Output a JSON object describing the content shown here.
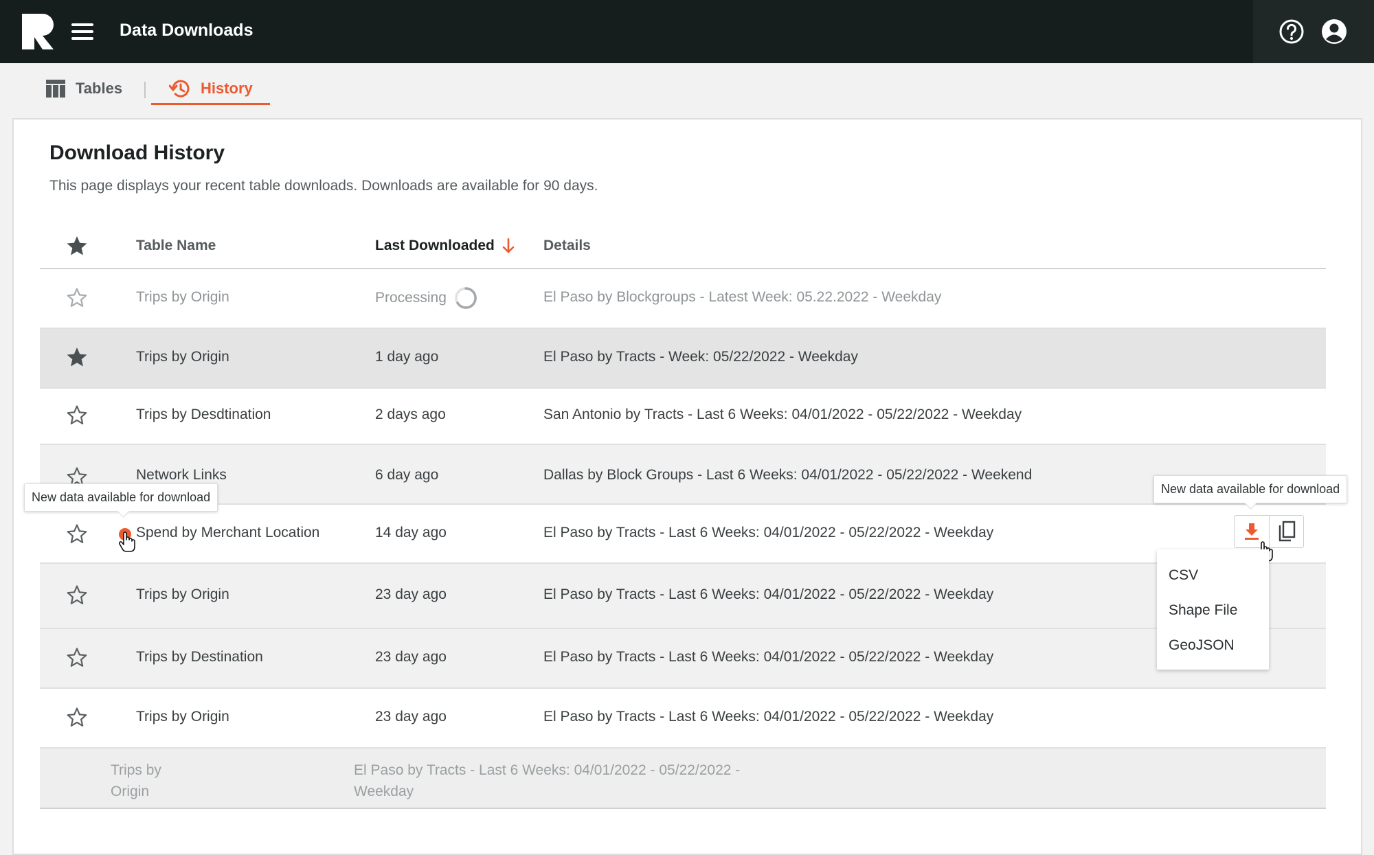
{
  "header": {
    "app_title": "Data Downloads",
    "logo_icon": "r-logo-icon",
    "menu_icon": "hamburger-menu-icon",
    "help_icon": "help-circle-icon",
    "account_icon": "account-circle-icon"
  },
  "tabs": [
    {
      "label": "Tables",
      "icon": "table-icon",
      "active": false
    },
    {
      "label": "History",
      "icon": "history-icon",
      "active": true
    }
  ],
  "page": {
    "title": "Download History",
    "subtitle": "This page displays your recent table downloads. Downloads are available for 90 days."
  },
  "table": {
    "columns": {
      "star": "star-icon",
      "name": "Table Name",
      "last_downloaded": "Last Downloaded",
      "details": "Details"
    },
    "sort": {
      "column": "Last Downloaded",
      "direction": "descending"
    },
    "rows": [
      {
        "starred": false,
        "name": "Trips by Origin",
        "last": "Processing",
        "details": "El Paso by Blockgroups - Latest Week: 05.22.2022 - Weekday",
        "status": "processing"
      },
      {
        "starred": true,
        "name": "Trips by Origin",
        "last": "1 day ago",
        "details": "El Paso by Tracts - Week: 05/22/2022 - Weekday"
      },
      {
        "starred": false,
        "name": "Trips by Desdtination",
        "last": "2 days ago",
        "details": "San Antonio by Tracts - Last 6 Weeks: 04/01/2022 - 05/22/2022 - Weekday"
      },
      {
        "starred": false,
        "name": "Network Links",
        "last": "6 day ago",
        "details": "Dallas by Block Groups - Last 6 Weeks: 04/01/2022 - 05/22/2022 - Weekend"
      },
      {
        "starred": false,
        "name": "Spend by Merchant Location",
        "last": "14 day ago",
        "details": "El Paso by Tracts - Last 6 Weeks: 04/01/2022 - 05/22/2022 - Weekday",
        "new_data": true
      },
      {
        "starred": false,
        "name": "Trips by Origin",
        "last": "23 day ago",
        "details": "El Paso by Tracts - Last 6 Weeks: 04/01/2022 - 05/22/2022 - Weekday"
      },
      {
        "starred": false,
        "name": "Trips by Destination",
        "last": "23 day ago",
        "details": "El Paso by Tracts - Last 6 Weeks: 04/01/2022 - 05/22/2022 - Weekday"
      },
      {
        "starred": false,
        "name": "Trips by Origin",
        "last": "23 day ago",
        "details": "El Paso by Tracts - Last 6 Weeks: 04/01/2022 - 05/22/2022 - Weekday"
      },
      {
        "starred": false,
        "name": "Trips by Origin",
        "last": "",
        "details": "El Paso by Tracts - Last 6 Weeks: 04/01/2022 - 05/22/2022 - Weekday"
      }
    ]
  },
  "tooltips": {
    "new_data_left": "New data available for download",
    "new_data_right": "New data available for download"
  },
  "actions": {
    "download_icon": "download-icon",
    "copy_icon": "copy-icon"
  },
  "download_menu": {
    "options": [
      "CSV",
      "Shape File",
      "GeoJSON"
    ]
  },
  "colors": {
    "accent": "#ec5a2f",
    "topbar": "#151d1d",
    "star_filled": "#4a4f52",
    "star_outline": "#5b6063"
  }
}
